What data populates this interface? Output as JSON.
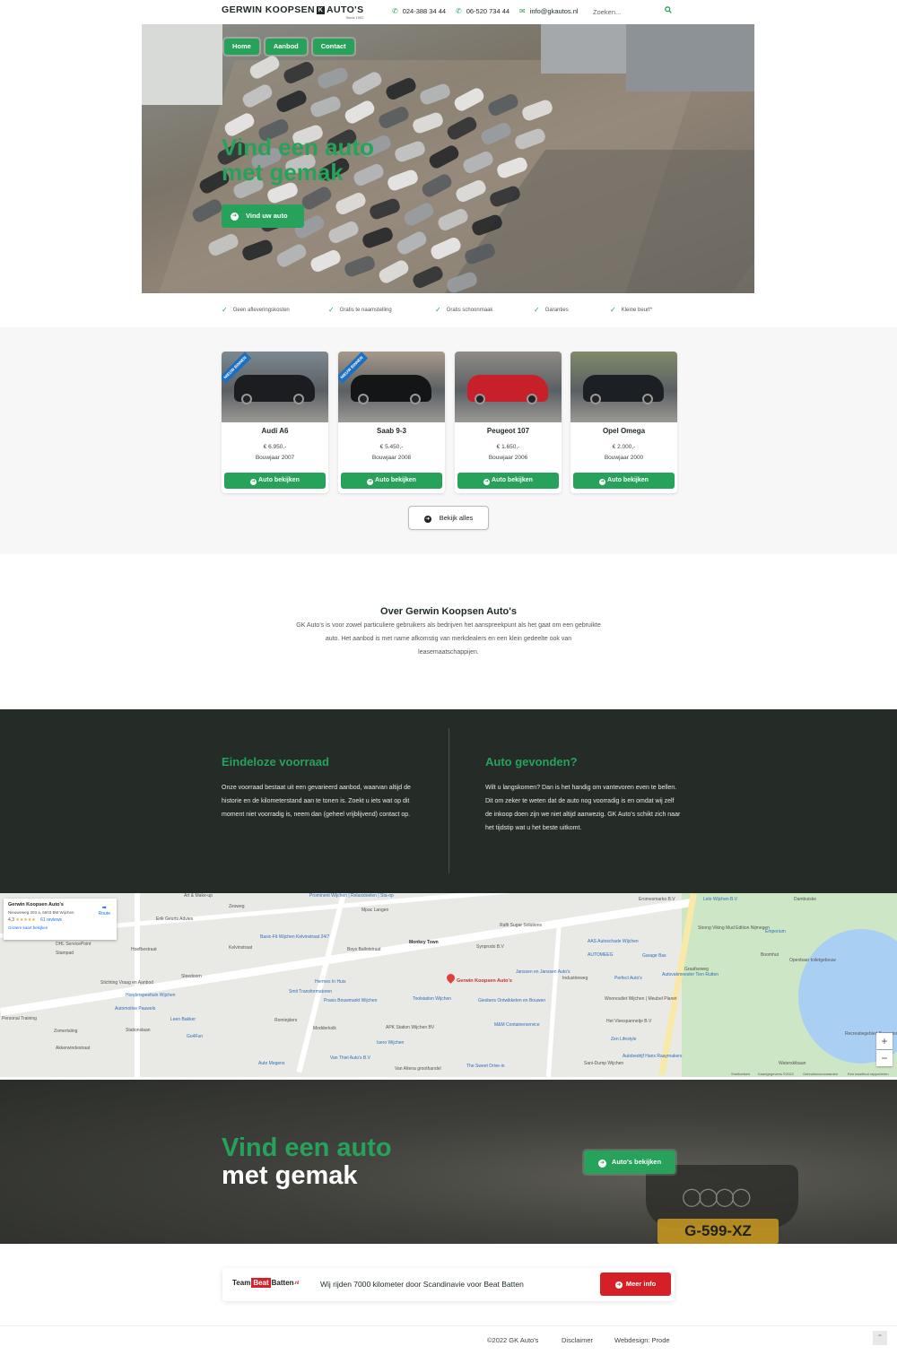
{
  "brand": {
    "logo_text": "GERWIN KOOPSEN",
    "logo_badge": "K",
    "logo_text2": "AUTO'S",
    "logo_sub": "Sinds 1992"
  },
  "contact": {
    "phone1": "024-388 34 44",
    "phone2": "06-520 734 44",
    "email": "info@gkautos.nl"
  },
  "search": {
    "placeholder": "Zoeken..."
  },
  "nav": [
    {
      "label": "Home"
    },
    {
      "label": "Aanbod"
    },
    {
      "label": "Contact"
    }
  ],
  "hero": {
    "title_line1": "Vind een auto",
    "title_line2": "met gemak",
    "cta": "Vind uw auto"
  },
  "usps": [
    "Geen afleveringskosten",
    "Gratis te naamstelling",
    "Gratis schoonmaak",
    "Garanties",
    "Kleine beurt*"
  ],
  "cars": [
    {
      "name": "Audi A6",
      "price": "€ 6.950,-",
      "year": "Bouwjaar 2007",
      "badge": "NIEUW BINNEN",
      "button": "Auto bekijken",
      "color": "#1b1d20"
    },
    {
      "name": "Saab 9-3",
      "price": "€ 5.450,-",
      "year": "Bouwjaar 2008",
      "badge": "NIEUW BINNEN",
      "button": "Auto bekijken",
      "color": "#141517"
    },
    {
      "name": "Peugeot 107",
      "price": "€ 1.650,-",
      "year": "Bouwjaar 2006",
      "badge": "",
      "button": "Auto bekijken",
      "color": "#c8202a"
    },
    {
      "name": "Opel Omega",
      "price": "€ 2.000,-",
      "year": "Bouwjaar 2000",
      "badge": "",
      "button": "Auto bekijken",
      "color": "#1c1f23"
    }
  ],
  "view_all": "Bekijk alles",
  "about": {
    "title": "Over Gerwin Koopsen Auto's",
    "text": "GK Auto's is voor zowel particuliere gebruikers als bedrijven het aanspreekpunt als het gaat om een gebruikte auto. Het aanbod is met name afkomstig van merkdealers en een klein gedeelte ook van leasemaatschappijen."
  },
  "features": [
    {
      "title": "Eindeloze voorraad",
      "text": "Onze voorraad bestaat uit een gevarieerd aanbod, waarvan altijd de historie en de kilometerstand aan te tonen is. Zoekt u iets wat op dit moment niet voorradig is, neem dan (geheel vrijblijvend) contact op."
    },
    {
      "title": "Auto gevonden?",
      "text": "Wilt u langskomen? Dan is het handig om vantevoren even te bellen. Dit om zeker te weten dat de auto nog voorradig is en omdat wij zelf de inkoop doen zijn we niet altijd aanwezig. GK Auto's schikt zich naar het tijdstip wat u het beste uitkomt."
    }
  ],
  "map": {
    "card_title": "Gerwin Koopsen Auto's",
    "card_address": "Nieuweweg 203 a, 6603 BM Wijchen",
    "rating": "4,3",
    "stars": "★★★★★",
    "reviews": "61 reviews",
    "larger_map": "Grotere kaart bekijken",
    "route": "Route",
    "pin_label": "Gerwin Koopsen Auto's",
    "zoom_in": "+",
    "zoom_out": "−",
    "labels": [
      "Art & Make-up",
      "Prominent Wijchen | Relaxstoelen | Sta-op",
      "Mpac Langen",
      "Eromesmarko B.V",
      "Lelo Wijchen B.V",
      "Dambuiske",
      "Erik Geurts Advies",
      "Rafti Sugar Solutions",
      "Strong Viking Mud Edition Nijmegen",
      "Emporium",
      "Basic-Fit Wijchen Kelvinstraat 24/7",
      "Monkey Town",
      "Synprodo B.V",
      "AAS Autoschade Wijchen",
      "AUTOMEEG",
      "Garage Bas",
      "Boomhut",
      "Openbaar toiletgebouw",
      "DHL ServicePoint",
      "Janssen en Janssen Auto's",
      "Perfect Auto's",
      "Autovakmeester Tien Rutten",
      "Hermes In Huis",
      "Smit Transformatoren",
      "Praxis Bouwmarkt Wijchen",
      "Toolstation Wijchen",
      "Giesbers Ontwikkelen en Bouwen",
      "Stichting Vraag en Aanbod",
      "Sleedoorn",
      "Honderspeeltuin Wijchen",
      "Automotive Pauwels",
      "Leen Bakker",
      "Rominjders",
      "Modderkolk",
      "APK Station Wijchen BV",
      "M&M Containerservice",
      "Woonoutlet Wijchen | Meubel Planet",
      "Het Vleespannetje B.V",
      "Zen Lifestyle",
      "Recreatiegebied Berendonck",
      "Isero Wijchen",
      "Van Thiel Auto's B.V",
      "Van Altena groothandel",
      "The Sweet Drive-in",
      "Autobedrijf Hans Raaymakers",
      "Sani-Dump Wijchen",
      "Waterskibaan",
      "Auto Megens",
      "Go4Fun",
      "Personal Training",
      "Stationslaan",
      "Zomertaling",
      "Akkerwindestraat",
      "Stampad",
      "Hoefbestraat",
      "Kelvinstraat",
      "Boys Ballotstraat",
      "Industrieweg",
      "Graafseweg",
      "Zesweg"
    ],
    "attrib": [
      "Sneltoetsen",
      "Kaartgegevens ©2022",
      "Gebruiksvoorwaarden",
      "Een kaartfout rapporteren"
    ]
  },
  "banner": {
    "title_line1": "Vind een auto",
    "title_line2": "met gemak",
    "cta": "Auto's bekijken",
    "plate": "G-599-XZ"
  },
  "promo": {
    "team": "Team",
    "beat": "Beat",
    "batten": "Batten",
    "nl": ".nl",
    "text": "Wij rijden 7000 kilometer door Scandinavie voor Beat Batten",
    "button": "Meer info"
  },
  "footer": {
    "copyright": "©2022 GK Auto's",
    "disclaimer": "Disclaimer",
    "webdesign": "Webdesign: Prode"
  },
  "colors": {
    "accent": "#27a25a",
    "dark": "#252c27",
    "promo_red": "#d62027"
  },
  "icons": {
    "phone": "phone-icon",
    "whatsapp": "whatsapp-icon",
    "email": "email-icon",
    "search": "search-icon",
    "check": "check-icon",
    "arrow": "arrow-circle-icon"
  }
}
